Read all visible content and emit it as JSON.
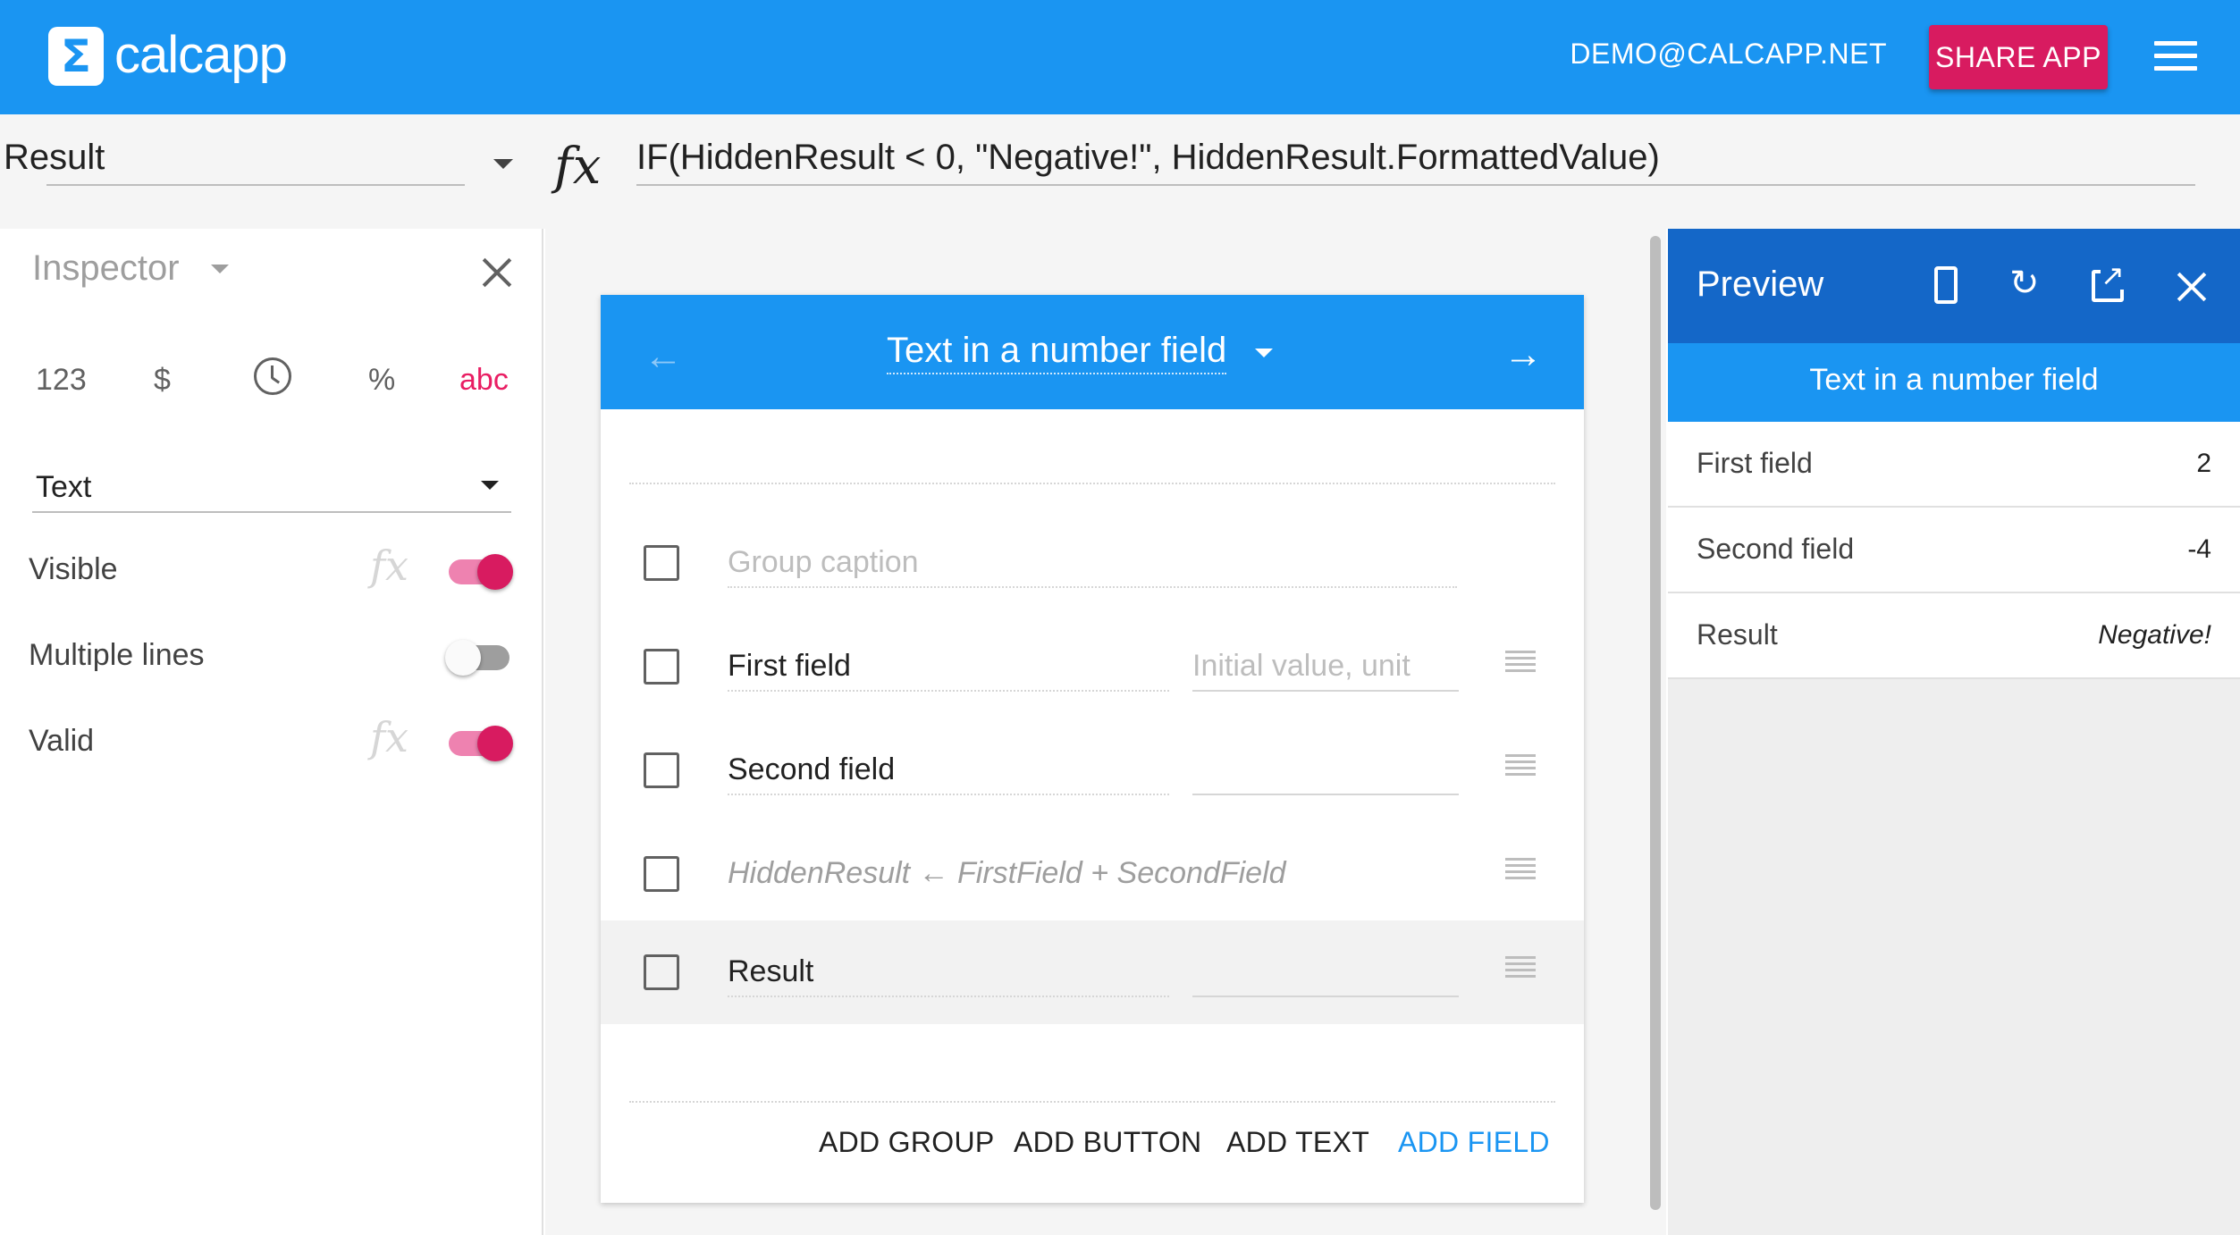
{
  "app": {
    "logo_glyph": "Σ",
    "logo_name": "calcapp",
    "user_email": "DEMO@CALCAPP.NET",
    "share_label": "SHARE APP",
    "brand_color": "#1a95f2",
    "accent_color": "#d81b60"
  },
  "formula_bar": {
    "selected_field": "Result",
    "fx_label": "fx",
    "formula": "IF(HiddenResult < 0, \"Negative!\", HiddenResult.FormattedValue)"
  },
  "inspector": {
    "title": "Inspector",
    "type_options": [
      "123",
      "$",
      "%",
      "abc"
    ],
    "active_type": "abc",
    "field_type": "Text",
    "properties": [
      {
        "label": "Visible",
        "has_formula": true,
        "on": true
      },
      {
        "label": "Multiple lines",
        "has_formula": false,
        "on": false
      },
      {
        "label": "Valid",
        "has_formula": true,
        "on": true
      }
    ]
  },
  "screen": {
    "title": "Text in a number field",
    "group_caption_placeholder": "Group caption",
    "rows": [
      {
        "name": "First field",
        "value_placeholder": "Initial value, unit"
      },
      {
        "name": "Second field",
        "value_placeholder": ""
      },
      {
        "name": "HiddenResult ← FirstField + SecondField",
        "value_placeholder": ""
      },
      {
        "name": "Result",
        "value_placeholder": ""
      }
    ],
    "actions": {
      "add_group": "ADD GROUP",
      "add_button": "ADD BUTTON",
      "add_text": "ADD TEXT",
      "add_field": "ADD FIELD"
    }
  },
  "preview": {
    "title": "Preview",
    "screen_title": "Text in a number field",
    "rows": [
      {
        "label": "First field",
        "value": "2"
      },
      {
        "label": "Second field",
        "value": "-4"
      },
      {
        "label": "Result",
        "value": "Negative!"
      }
    ]
  }
}
